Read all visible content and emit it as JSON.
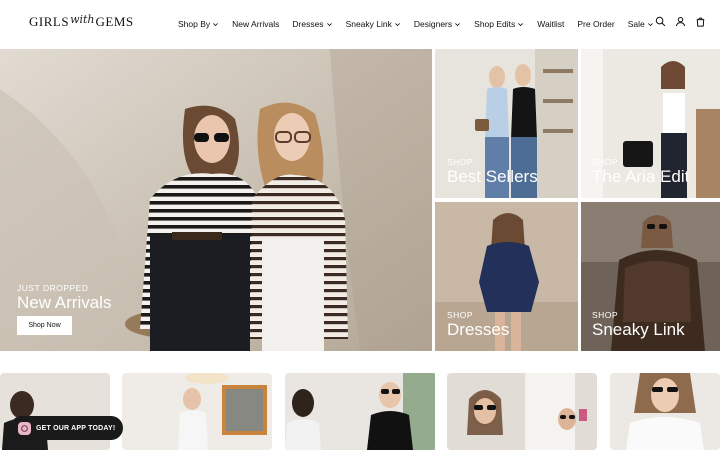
{
  "brand": {
    "part1": "GIRLS",
    "script": "with",
    "part2": "GEMS"
  },
  "nav": [
    {
      "label": "Shop By",
      "dropdown": true
    },
    {
      "label": "New Arrivals",
      "dropdown": false
    },
    {
      "label": "Dresses",
      "dropdown": true
    },
    {
      "label": "Sneaky Link",
      "dropdown": true
    },
    {
      "label": "Designers",
      "dropdown": true
    },
    {
      "label": "Shop Edits",
      "dropdown": true
    },
    {
      "label": "Waitlist",
      "dropdown": false
    },
    {
      "label": "Pre Order",
      "dropdown": false
    },
    {
      "label": "Sale",
      "dropdown": true
    }
  ],
  "header_icons": [
    "search-icon",
    "account-icon",
    "cart-icon"
  ],
  "hero": {
    "overline": "JUST DROPPED",
    "title": "New Arrivals",
    "button": "Shop Now"
  },
  "tiles": [
    {
      "overline": "SHOP",
      "title": "Best Sellers"
    },
    {
      "overline": "SHOP",
      "title": "The Aria Edit"
    },
    {
      "overline": "SHOP",
      "title": "Dresses"
    },
    {
      "overline": "SHOP",
      "title": "Sneaky Link"
    }
  ],
  "app_banner": {
    "label": "GET OUR APP TODAY!"
  },
  "colors": {
    "text": "#111111",
    "background": "#ffffff",
    "pill": "#1a1a1a",
    "app_logo": "#e8b8c6"
  }
}
